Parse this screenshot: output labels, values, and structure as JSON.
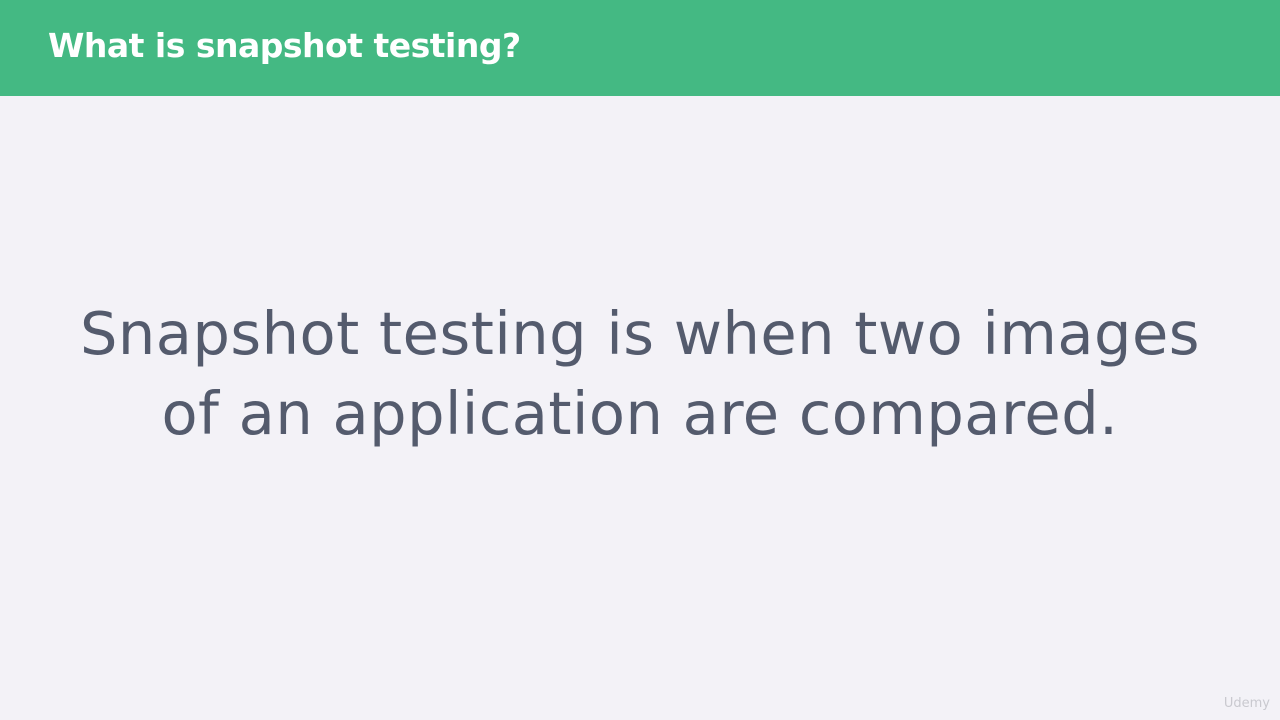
{
  "slide": {
    "title": "What is snapshot testing?",
    "statement_lines": [
      "Snapshot testing is when two images",
      "of an application are compared."
    ],
    "watermark": "Udemy"
  },
  "colors": {
    "header_background": "#44b983",
    "page_background": "#f3f2f7",
    "statement_text": "#545b6d",
    "title_text": "#ffffff"
  }
}
